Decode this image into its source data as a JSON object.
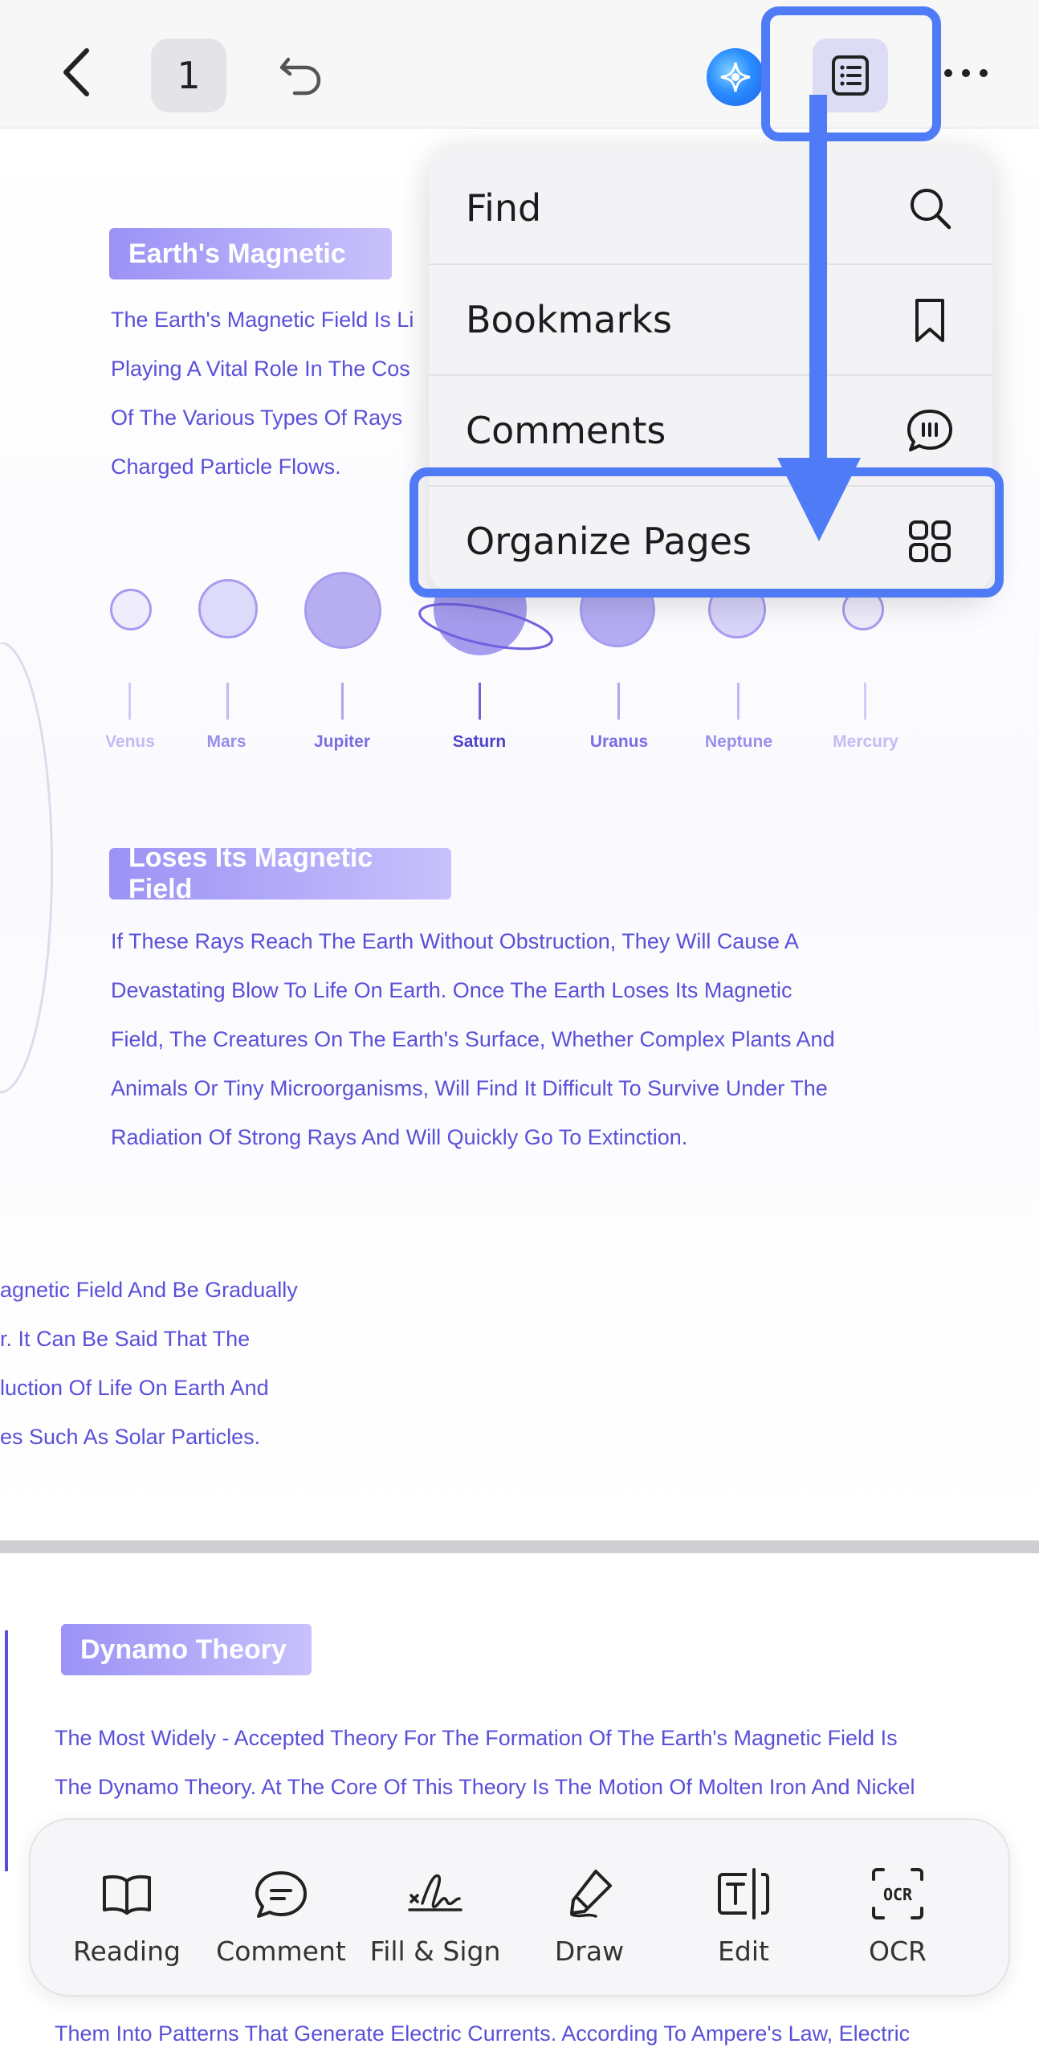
{
  "topbar": {
    "page_number": "1"
  },
  "menu": {
    "items": [
      {
        "label": "Find",
        "icon": "search-icon"
      },
      {
        "label": "Bookmarks",
        "icon": "bookmark-icon"
      },
      {
        "label": "Comments",
        "icon": "comment-bubble-icon"
      },
      {
        "label": "Organize Pages",
        "icon": "grid-icon"
      }
    ]
  },
  "document": {
    "section1_title": "Earth's Magnetic",
    "section1_lines": [
      "The Earth's Magnetic Field Is Li",
      "Playing A Vital Role In The Cos",
      "Of The Various Types Of Rays",
      "Charged Particle Flows."
    ],
    "planets": [
      "Venus",
      "Mars",
      "Jupiter",
      "Saturn",
      "Uranus",
      "Neptune",
      "Mercury"
    ],
    "section2_title": "Loses Its Magnetic Field",
    "section2_lines": [
      "If These Rays Reach The Earth Without Obstruction, They Will Cause A",
      "Devastating Blow To Life On Earth. Once The Earth Loses Its Magnetic",
      "Field, The Creatures On The Earth's Surface, Whether Complex Plants And",
      "Animals Or Tiny Microorganisms, Will Find It Difficult To Survive Under The",
      "Radiation Of Strong Rays And Will Quickly Go To Extinction."
    ],
    "section3_lines": [
      "agnetic Field And Be Gradually",
      "r. It Can Be Said That The",
      "luction Of Life On Earth And",
      "es Such As Solar Particles."
    ],
    "section4_title": "Dynamo Theory",
    "section4_lines": [
      "The Most Widely - Accepted Theory For The Formation Of The Earth's Magnetic Field Is",
      "The Dynamo Theory. At The Core Of This Theory Is The Motion Of Molten Iron And Nickel"
    ],
    "section4_bottom_line": "Them Into Patterns That Generate Electric Currents. According To Ampere's Law, Electric"
  },
  "toolbar": {
    "items": [
      {
        "label": "Reading",
        "icon": "book-icon"
      },
      {
        "label": "Comment",
        "icon": "comment-icon"
      },
      {
        "label": "Fill & Sign",
        "icon": "signature-icon"
      },
      {
        "label": "Draw",
        "icon": "pen-icon"
      },
      {
        "label": "Edit",
        "icon": "text-edit-icon"
      },
      {
        "label": "OCR",
        "icon": "ocr-icon"
      }
    ]
  },
  "colors": {
    "highlight": "#4f7cf6",
    "doc_text": "#5a50d8",
    "section_chip": "#9c92f6"
  }
}
